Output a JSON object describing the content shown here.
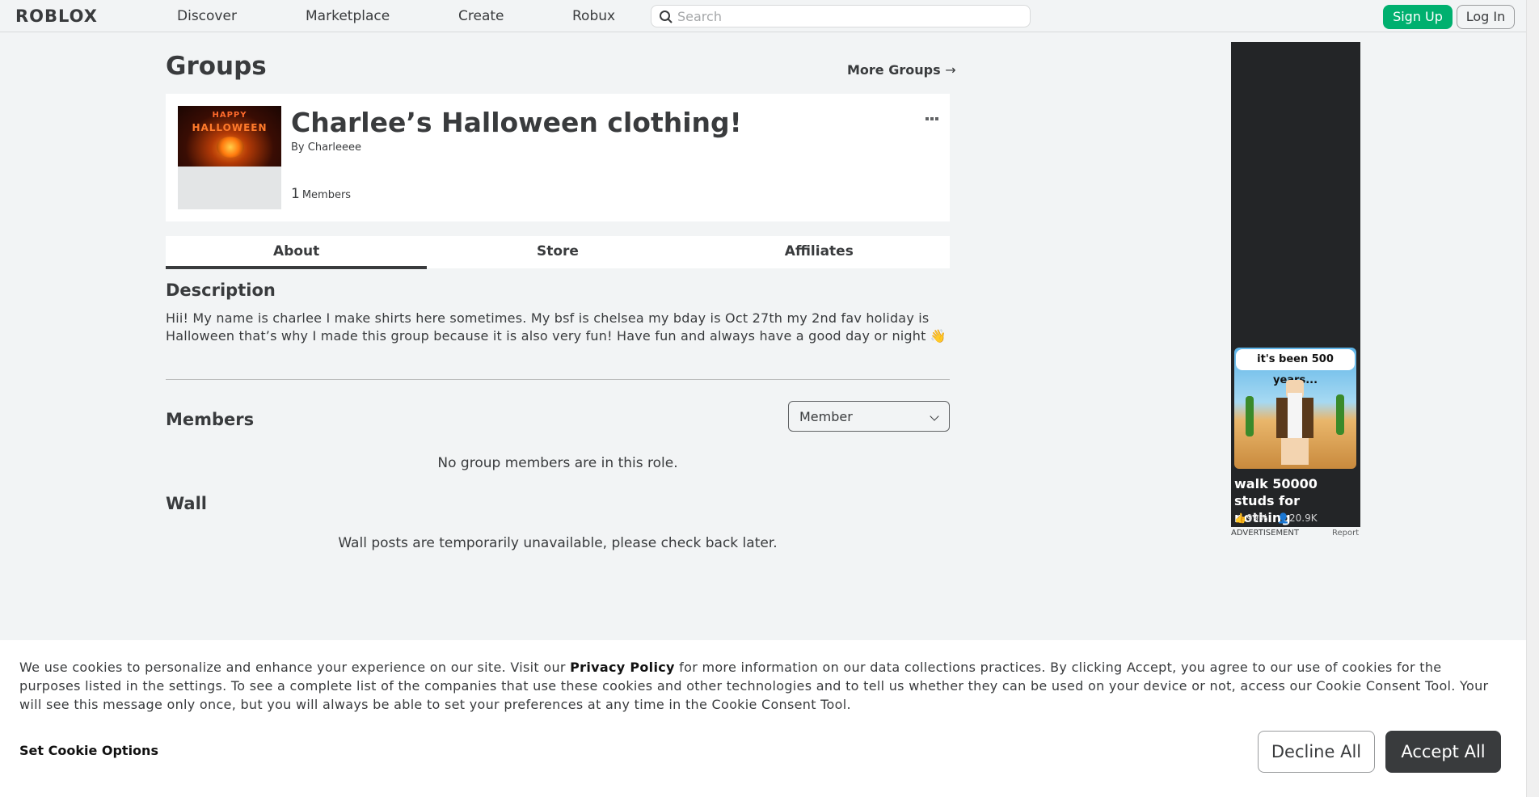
{
  "nav": {
    "logo": "ROBLOX",
    "links": [
      "Discover",
      "Marketplace",
      "Create",
      "Robux"
    ],
    "search_placeholder": "Search",
    "signup": "Sign Up",
    "login": "Log In"
  },
  "page": {
    "title": "Groups",
    "more_groups": "More Groups",
    "more_groups_arrow": "→"
  },
  "group": {
    "emblem_text_1": "HAPPY",
    "emblem_text_2": "HALLOWEEN",
    "name": "Charlee’s Halloween clothing!",
    "owner_prefix": "By",
    "owner": "Charleeee",
    "member_count": "1",
    "member_label": "Members"
  },
  "tabs": [
    "About",
    "Store",
    "Affiliates"
  ],
  "about": {
    "description_title": "Description",
    "description": "Hii! My name is charlee I make shirts here sometimes. My bsf is chelsea my bday is Oct 27th my 2nd fav holiday is Halloween that’s why I made this group because it is also very fun! Have fun and always have a good day or night 👋",
    "members_title": "Members",
    "role_selected": "Member",
    "no_members": "No group members are in this role.",
    "wall_title": "Wall",
    "wall_msg": "Wall posts are temporarily unavailable, please check back later."
  },
  "ad": {
    "bubble": "it's been 500 years...",
    "caption": "walk 50000 studs for nothing",
    "rating": "99%",
    "players": "20.9K",
    "label": "ADVERTISEMENT",
    "report": "Report"
  },
  "cookie": {
    "text_before": "We use cookies to personalize and enhance your experience on our site. Visit our ",
    "privacy_link": "Privacy Policy",
    "text_after": " for more information on our data collections practices. By clicking Accept, you agree to our use of cookies for the purposes listed in the settings. To see a complete list of the companies that use these cookies and other technologies and to tell us whether they can be used on your device or not, access our Cookie Consent Tool. Your will see this message only once, but you will always be able to set your preferences at any time in the Cookie Consent Tool.",
    "options": "Set Cookie Options",
    "decline": "Decline All",
    "accept": "Accept All"
  },
  "colors": {
    "brand_green": "#00b06f",
    "text_dark": "#393b3d",
    "background": "#f2f4f5"
  }
}
